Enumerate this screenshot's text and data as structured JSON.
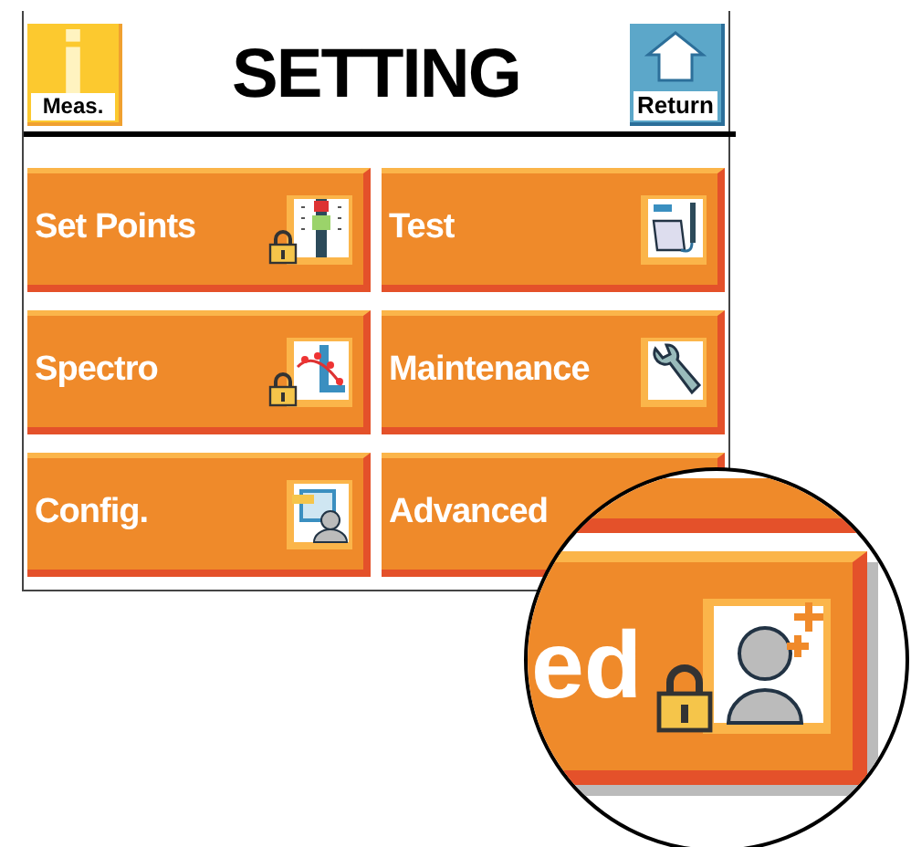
{
  "header": {
    "title": "SETTING",
    "left_button": {
      "label": "Meas."
    },
    "right_button": {
      "label": "Return"
    }
  },
  "tiles": [
    {
      "label": "Set Points",
      "kind": "slider",
      "locked": true
    },
    {
      "label": "Test",
      "kind": "analyzer",
      "locked": false
    },
    {
      "label": "Spectro",
      "kind": "spectrum",
      "locked": true
    },
    {
      "label": "Maintenance",
      "kind": "wrench",
      "locked": false
    },
    {
      "label": "Config.",
      "kind": "config",
      "locked": false
    },
    {
      "label": "Advanced"
    }
  ],
  "magnifier": {
    "label": "ed",
    "kind": "user",
    "locked": true
  }
}
